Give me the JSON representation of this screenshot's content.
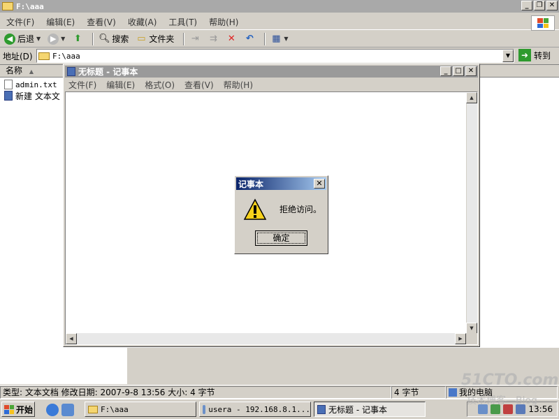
{
  "explorer": {
    "title": "F:\\aaa",
    "menu": [
      "文件(F)",
      "编辑(E)",
      "查看(V)",
      "收藏(A)",
      "工具(T)",
      "帮助(H)"
    ],
    "toolbar": {
      "back": "后退",
      "search": "搜索",
      "folders": "文件夹"
    },
    "address": {
      "label": "地址(D)",
      "value": "F:\\aaa",
      "go": "转到"
    },
    "list": {
      "column_name": "名称",
      "files": [
        {
          "name": "admin.txt"
        },
        {
          "name": "新建 文本文"
        }
      ]
    },
    "status": {
      "info": "类型: 文本文档 修改日期: 2007-9-8 13:56 大小: 4 字节",
      "size": "4 字节",
      "zone": "我的电脑"
    }
  },
  "notepad": {
    "title": "无标题 - 记事本",
    "menu": [
      "文件(F)",
      "编辑(E)",
      "格式(O)",
      "查看(V)",
      "帮助(H)"
    ]
  },
  "dialog": {
    "title": "记事本",
    "message": "拒绝访问。",
    "ok": "确定"
  },
  "taskbar": {
    "start": "开始",
    "tasks": [
      {
        "label": "F:\\aaa"
      },
      {
        "label": "usera - 192.168.8.1..."
      },
      {
        "label": "无标题 - 记事本"
      }
    ],
    "clock": "13:56"
  },
  "watermark": {
    "line1": "51CTO.com",
    "line2": "技术博客—Blog"
  },
  "colors": {
    "dialog_title_start": "#0a246a",
    "dialog_title_end": "#a6caf0",
    "inactive_title": "#9a9a9a"
  }
}
